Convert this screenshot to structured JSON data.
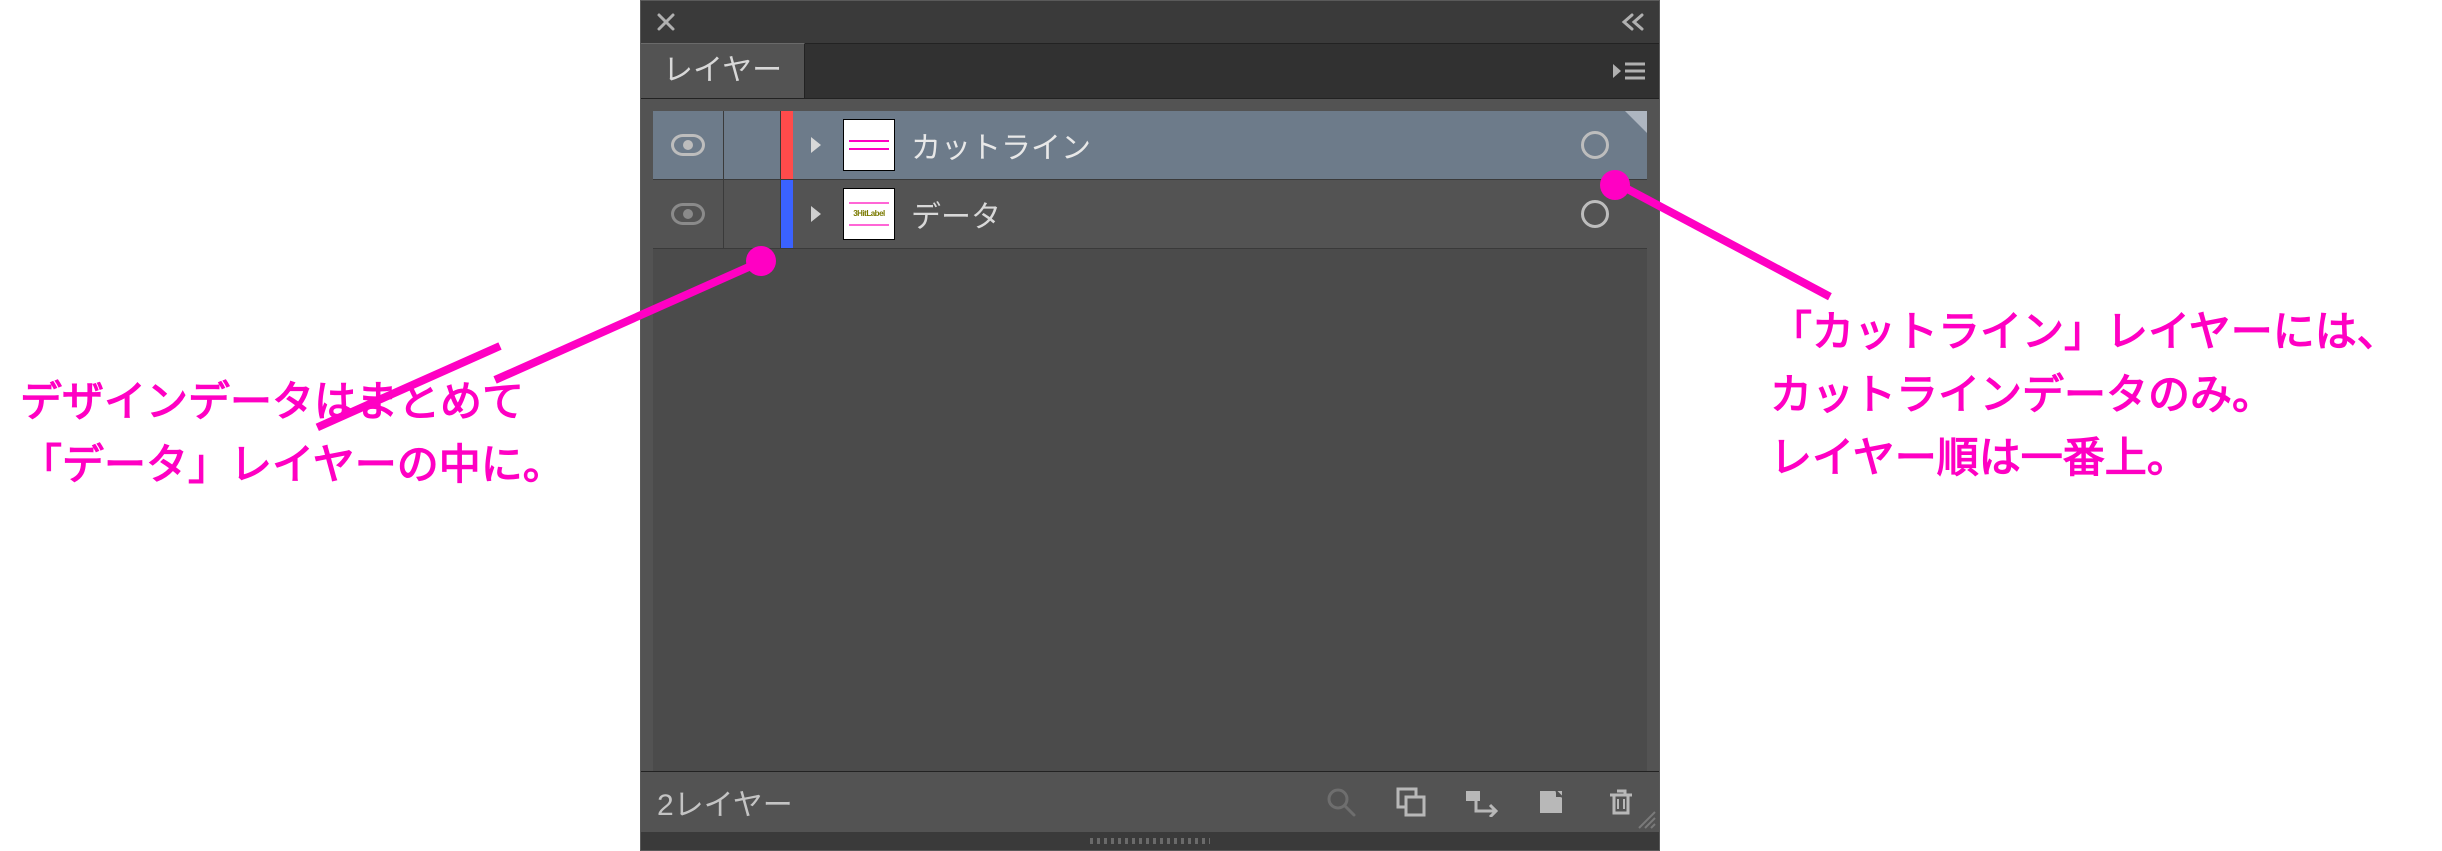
{
  "panel": {
    "tab_label": "レイヤー",
    "layers": [
      {
        "name": "カットライン",
        "color": "#ff4b4b",
        "selected": true,
        "thumb": "cutline"
      },
      {
        "name": "データ",
        "color": "#3a62ff",
        "selected": false,
        "thumb": "data"
      }
    ],
    "footer_count": "2レイヤー"
  },
  "annotations": {
    "left": "デザインデータはまとめて\n「データ」レイヤーの中に。",
    "right": "「カットライン」レイヤーには、\nカットラインデータのみ。\nレイヤー順は一番上。"
  }
}
